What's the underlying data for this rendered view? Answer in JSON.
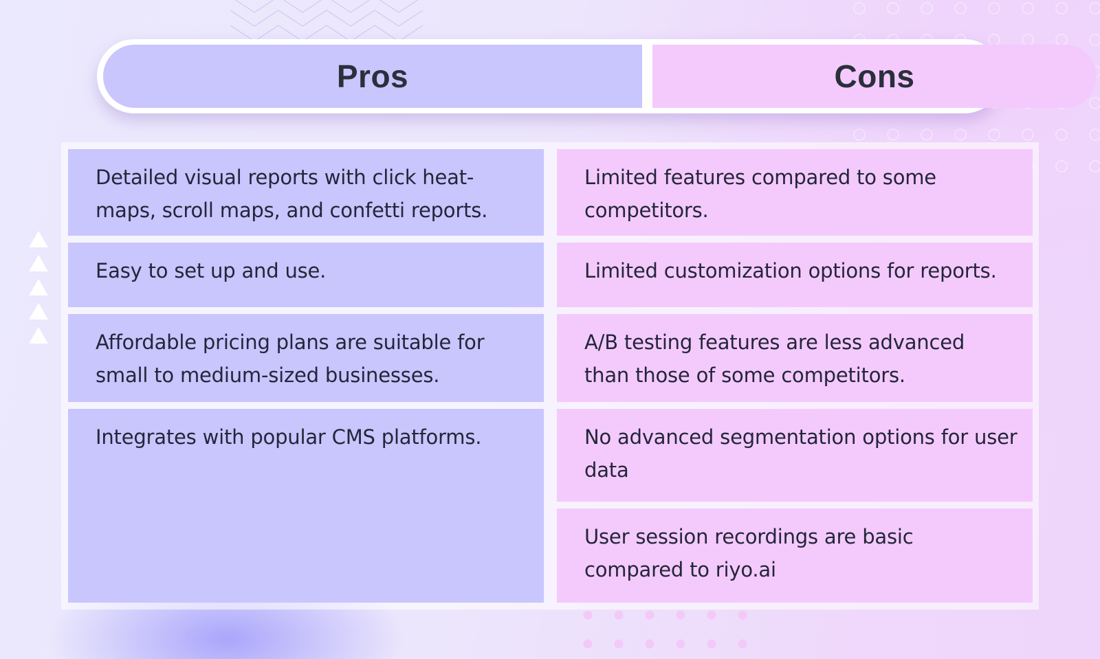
{
  "header": {
    "pros_title": "Pros",
    "cons_title": "Cons"
  },
  "pros": [
    "Detailed visual reports with click heat-maps, scroll maps, and confetti reports.",
    "Easy to set up and use.",
    "Affordable pricing plans are suitable for small to medium-sized businesses.",
    "Integrates with popular CMS platforms."
  ],
  "cons": [
    "Limited features compared to some competitors.",
    "Limited customization options for reports.",
    "A/B testing features are less advanced than those of some competitors.",
    "No advanced segmentation options for user data",
    "User session recordings are basic compared to riyo.ai"
  ],
  "colors": {
    "pros_fill": "#c9c5fd",
    "cons_fill": "#f4cafc",
    "text": "#23263a",
    "heading_text": "#2a2f3b"
  },
  "decorations": {
    "left_triangle_icons": 5
  }
}
